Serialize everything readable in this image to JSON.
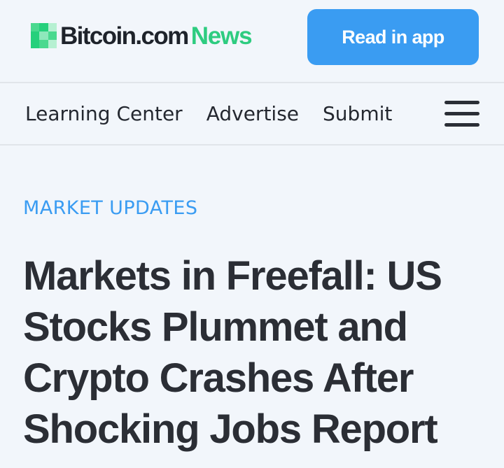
{
  "header": {
    "logo": {
      "brand": "Bitcoin.com",
      "product": "News",
      "icon": "bitcoin-com-pixel-logo-icon",
      "colors": {
        "brand_text": "#1e232b",
        "product_text": "#2ecc80",
        "mark": [
          "#26d07c",
          "#8ee8bb",
          "#4ad98f",
          "#b6f0d2"
        ]
      }
    },
    "read_in_app_label": "Read in app",
    "accent_color": "#3a9cf2"
  },
  "nav": {
    "items": [
      {
        "label": "Learning Center"
      },
      {
        "label": "Advertise"
      },
      {
        "label": "Submit"
      }
    ],
    "menu_icon": "hamburger-menu-icon"
  },
  "article": {
    "category": "MARKET UPDATES",
    "category_color": "#3a9cf2",
    "title": "Markets in Freefall: US Stocks Plummet and Crypto Crashes After Shocking Jobs Report"
  }
}
